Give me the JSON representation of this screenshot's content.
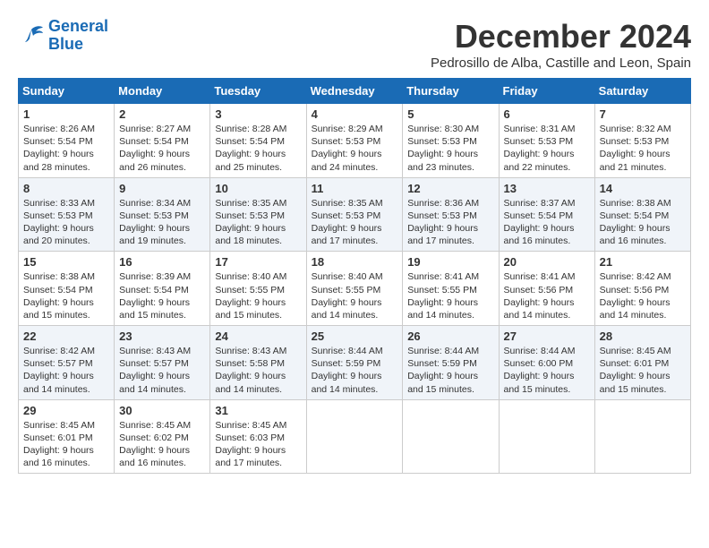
{
  "header": {
    "logo_line1": "General",
    "logo_line2": "Blue",
    "month": "December 2024",
    "location": "Pedrosillo de Alba, Castille and Leon, Spain"
  },
  "weekdays": [
    "Sunday",
    "Monday",
    "Tuesday",
    "Wednesday",
    "Thursday",
    "Friday",
    "Saturday"
  ],
  "weeks": [
    [
      {
        "day": "1",
        "info": "Sunrise: 8:26 AM\nSunset: 5:54 PM\nDaylight: 9 hours and 28 minutes."
      },
      {
        "day": "2",
        "info": "Sunrise: 8:27 AM\nSunset: 5:54 PM\nDaylight: 9 hours and 26 minutes."
      },
      {
        "day": "3",
        "info": "Sunrise: 8:28 AM\nSunset: 5:54 PM\nDaylight: 9 hours and 25 minutes."
      },
      {
        "day": "4",
        "info": "Sunrise: 8:29 AM\nSunset: 5:53 PM\nDaylight: 9 hours and 24 minutes."
      },
      {
        "day": "5",
        "info": "Sunrise: 8:30 AM\nSunset: 5:53 PM\nDaylight: 9 hours and 23 minutes."
      },
      {
        "day": "6",
        "info": "Sunrise: 8:31 AM\nSunset: 5:53 PM\nDaylight: 9 hours and 22 minutes."
      },
      {
        "day": "7",
        "info": "Sunrise: 8:32 AM\nSunset: 5:53 PM\nDaylight: 9 hours and 21 minutes."
      }
    ],
    [
      {
        "day": "8",
        "info": "Sunrise: 8:33 AM\nSunset: 5:53 PM\nDaylight: 9 hours and 20 minutes."
      },
      {
        "day": "9",
        "info": "Sunrise: 8:34 AM\nSunset: 5:53 PM\nDaylight: 9 hours and 19 minutes."
      },
      {
        "day": "10",
        "info": "Sunrise: 8:35 AM\nSunset: 5:53 PM\nDaylight: 9 hours and 18 minutes."
      },
      {
        "day": "11",
        "info": "Sunrise: 8:35 AM\nSunset: 5:53 PM\nDaylight: 9 hours and 17 minutes."
      },
      {
        "day": "12",
        "info": "Sunrise: 8:36 AM\nSunset: 5:53 PM\nDaylight: 9 hours and 17 minutes."
      },
      {
        "day": "13",
        "info": "Sunrise: 8:37 AM\nSunset: 5:54 PM\nDaylight: 9 hours and 16 minutes."
      },
      {
        "day": "14",
        "info": "Sunrise: 8:38 AM\nSunset: 5:54 PM\nDaylight: 9 hours and 16 minutes."
      }
    ],
    [
      {
        "day": "15",
        "info": "Sunrise: 8:38 AM\nSunset: 5:54 PM\nDaylight: 9 hours and 15 minutes."
      },
      {
        "day": "16",
        "info": "Sunrise: 8:39 AM\nSunset: 5:54 PM\nDaylight: 9 hours and 15 minutes."
      },
      {
        "day": "17",
        "info": "Sunrise: 8:40 AM\nSunset: 5:55 PM\nDaylight: 9 hours and 15 minutes."
      },
      {
        "day": "18",
        "info": "Sunrise: 8:40 AM\nSunset: 5:55 PM\nDaylight: 9 hours and 14 minutes."
      },
      {
        "day": "19",
        "info": "Sunrise: 8:41 AM\nSunset: 5:55 PM\nDaylight: 9 hours and 14 minutes."
      },
      {
        "day": "20",
        "info": "Sunrise: 8:41 AM\nSunset: 5:56 PM\nDaylight: 9 hours and 14 minutes."
      },
      {
        "day": "21",
        "info": "Sunrise: 8:42 AM\nSunset: 5:56 PM\nDaylight: 9 hours and 14 minutes."
      }
    ],
    [
      {
        "day": "22",
        "info": "Sunrise: 8:42 AM\nSunset: 5:57 PM\nDaylight: 9 hours and 14 minutes."
      },
      {
        "day": "23",
        "info": "Sunrise: 8:43 AM\nSunset: 5:57 PM\nDaylight: 9 hours and 14 minutes."
      },
      {
        "day": "24",
        "info": "Sunrise: 8:43 AM\nSunset: 5:58 PM\nDaylight: 9 hours and 14 minutes."
      },
      {
        "day": "25",
        "info": "Sunrise: 8:44 AM\nSunset: 5:59 PM\nDaylight: 9 hours and 14 minutes."
      },
      {
        "day": "26",
        "info": "Sunrise: 8:44 AM\nSunset: 5:59 PM\nDaylight: 9 hours and 15 minutes."
      },
      {
        "day": "27",
        "info": "Sunrise: 8:44 AM\nSunset: 6:00 PM\nDaylight: 9 hours and 15 minutes."
      },
      {
        "day": "28",
        "info": "Sunrise: 8:45 AM\nSunset: 6:01 PM\nDaylight: 9 hours and 15 minutes."
      }
    ],
    [
      {
        "day": "29",
        "info": "Sunrise: 8:45 AM\nSunset: 6:01 PM\nDaylight: 9 hours and 16 minutes."
      },
      {
        "day": "30",
        "info": "Sunrise: 8:45 AM\nSunset: 6:02 PM\nDaylight: 9 hours and 16 minutes."
      },
      {
        "day": "31",
        "info": "Sunrise: 8:45 AM\nSunset: 6:03 PM\nDaylight: 9 hours and 17 minutes."
      },
      null,
      null,
      null,
      null
    ]
  ]
}
